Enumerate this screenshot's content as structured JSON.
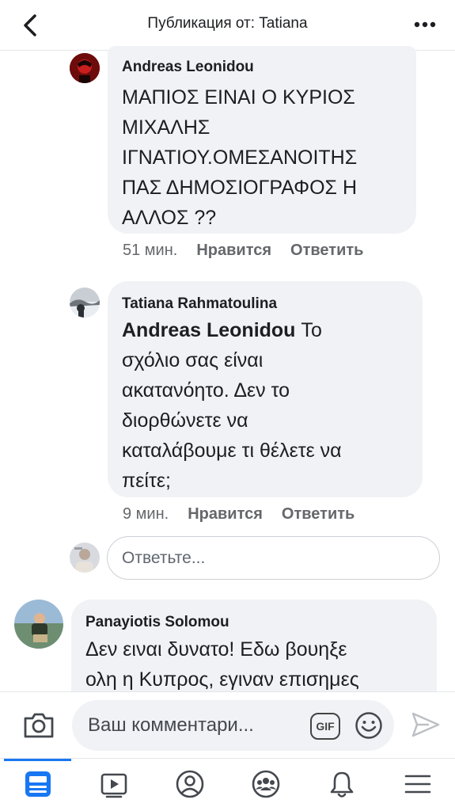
{
  "header": {
    "title": "Публикация от: Tatiana",
    "back_icon": "chevron-left-icon",
    "more_icon": "more-dots-icon"
  },
  "comments": [
    {
      "author": "Andreas Leonidou",
      "text_lines": [
        "ΜΑΠΙΟΣ ΕΙΝΑΙ Ο ΚΥΡΙΟΣ",
        "ΜΙΧΑΛΗΣ",
        "ΙΓΝΑΤΙΟΥ.ΟΜΕΣΑΝΟΙΤΗΣ",
        "ΠΑΣ ΔΗΜΟΣΙΟΓΡΑΦΟΣ Η",
        "ΑΛΛΟΣ ??"
      ],
      "time": "51 мин.",
      "like": "Нравится",
      "reply": "Ответить"
    },
    {
      "author": "Tatiana Rahmatoulina",
      "mention": "Andreas Leonidou",
      "text_first": " Το",
      "text_lines": [
        "σχόλιο σας είναι",
        "ακατανόητο. Δεν το",
        "διορθώνετε να",
        "καταλάβουμε τι θέλετε να",
        "πείτε;"
      ],
      "time": "9 мин.",
      "like": "Нравится",
      "reply": "Ответить"
    },
    {
      "author": "Panayiotis Solomou",
      "text_lines": [
        "Δεν ειναι δυνατο! Εδω βουηξε",
        "ολη η Κυπρος, εγιναν επισημες"
      ]
    }
  ],
  "reply_input": {
    "placeholder": "Ответьте..."
  },
  "composer": {
    "placeholder": "Ваш комментари...",
    "gif_label": "GIF"
  },
  "tabs": [
    {
      "icon": "news-feed-icon",
      "active": true
    },
    {
      "icon": "watch-video-icon"
    },
    {
      "icon": "profile-icon"
    },
    {
      "icon": "groups-icon"
    },
    {
      "icon": "notifications-bell-icon"
    },
    {
      "icon": "menu-icon"
    }
  ],
  "colors": {
    "accent": "#1877f2",
    "bubble": "#f0f2f5",
    "meta": "#65676b"
  }
}
